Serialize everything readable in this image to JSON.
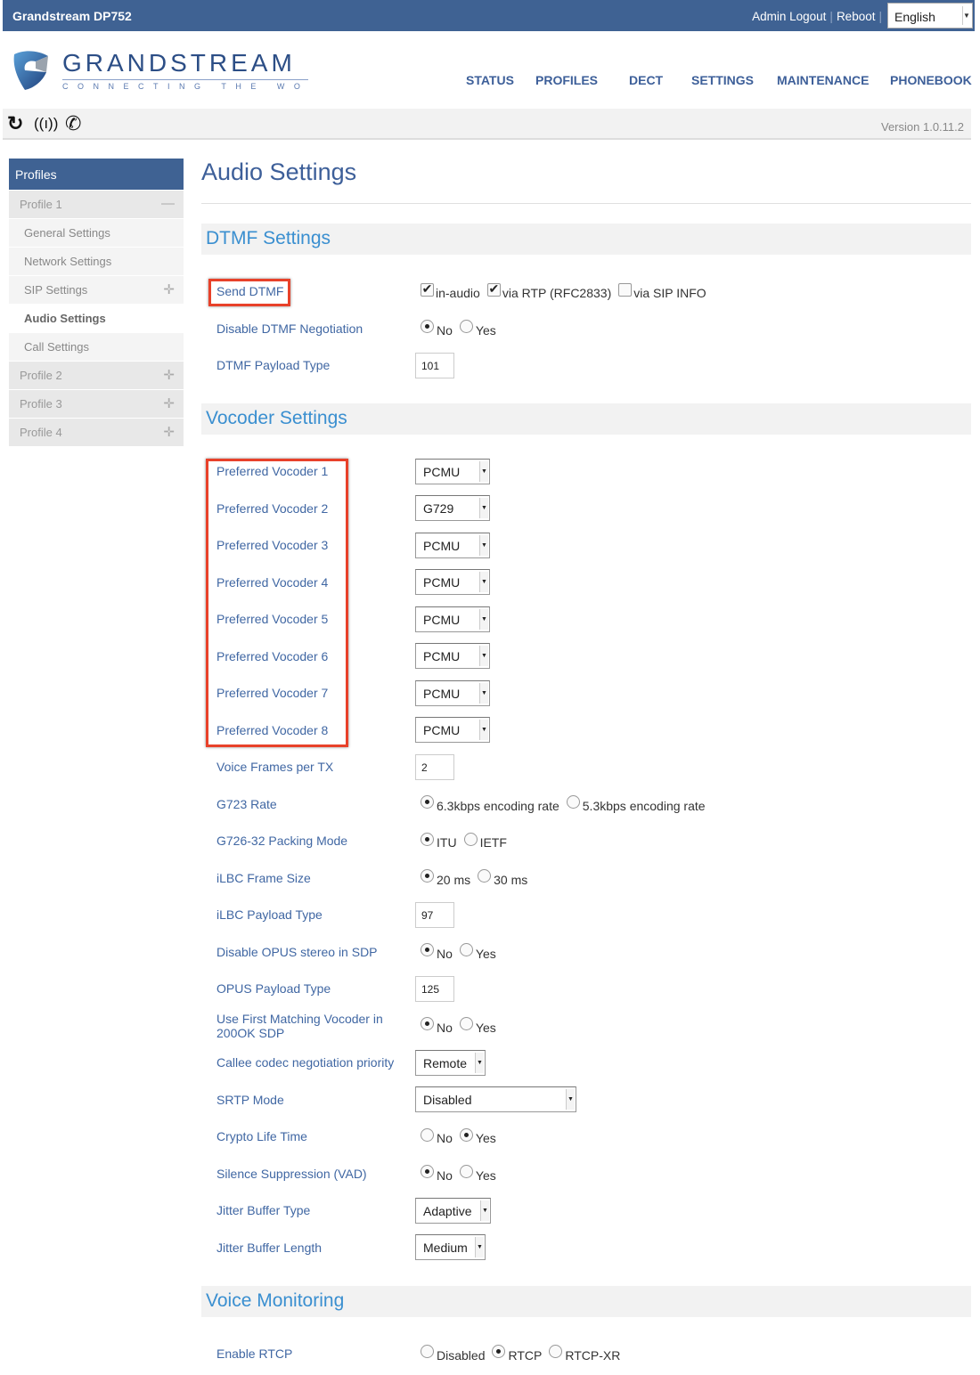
{
  "header": {
    "title": "Grandstream DP752",
    "admin_logout": "Admin Logout",
    "reboot": "Reboot",
    "language": "English"
  },
  "logo": {
    "brand": "GRANDSTREAM",
    "tagline": "CONNECTING THE WORLD"
  },
  "nav": [
    "STATUS",
    "PROFILES",
    "DECT",
    "SETTINGS",
    "MAINTENANCE",
    "PHONEBOOK"
  ],
  "toolbar": {
    "icons": [
      "refresh-icon",
      "antenna-icon",
      "phone-call-icon"
    ],
    "version": "Version 1.0.11.2"
  },
  "sidebar": {
    "title": "Profiles",
    "items": [
      {
        "label": "Profile 1",
        "type": "group",
        "expander": "minus"
      },
      {
        "label": "General Settings",
        "type": "sub"
      },
      {
        "label": "Network Settings",
        "type": "sub"
      },
      {
        "label": "SIP Settings",
        "type": "sub",
        "expander": "plus"
      },
      {
        "label": "Audio Settings",
        "type": "active"
      },
      {
        "label": "Call Settings",
        "type": "sub"
      },
      {
        "label": "Profile 2",
        "type": "group",
        "expander": "plus"
      },
      {
        "label": "Profile 3",
        "type": "group",
        "expander": "plus"
      },
      {
        "label": "Profile 4",
        "type": "group",
        "expander": "plus"
      }
    ]
  },
  "page_title": "Audio Settings",
  "sections": [
    {
      "title": "DTMF Settings",
      "rows": [
        {
          "label": "Send DTMF",
          "type": "checkbox",
          "options": [
            {
              "label": "in-audio",
              "checked": true
            },
            {
              "label": "via RTP (RFC2833)",
              "checked": true
            },
            {
              "label": "via SIP INFO",
              "checked": false
            }
          ]
        },
        {
          "label": "Disable DTMF Negotiation",
          "type": "radio",
          "options": [
            "No",
            "Yes"
          ],
          "selected": "No"
        },
        {
          "label": "DTMF Payload Type",
          "type": "text",
          "value": "101"
        }
      ]
    },
    {
      "title": "Vocoder Settings",
      "rows": [
        {
          "label": "Preferred Vocoder 1",
          "type": "select",
          "value": "PCMU"
        },
        {
          "label": "Preferred Vocoder 2",
          "type": "select",
          "value": "G729"
        },
        {
          "label": "Preferred Vocoder 3",
          "type": "select",
          "value": "PCMU"
        },
        {
          "label": "Preferred Vocoder 4",
          "type": "select",
          "value": "PCMU"
        },
        {
          "label": "Preferred Vocoder 5",
          "type": "select",
          "value": "PCMU"
        },
        {
          "label": "Preferred Vocoder 6",
          "type": "select",
          "value": "PCMU"
        },
        {
          "label": "Preferred Vocoder 7",
          "type": "select",
          "value": "PCMU"
        },
        {
          "label": "Preferred Vocoder 8",
          "type": "select",
          "value": "PCMU"
        },
        {
          "label": "Voice Frames per TX",
          "type": "text",
          "value": "2"
        },
        {
          "label": "G723 Rate",
          "type": "radio",
          "options": [
            "6.3kbps encoding rate",
            "5.3kbps encoding rate"
          ],
          "selected": "6.3kbps encoding rate"
        },
        {
          "label": "G726-32 Packing Mode",
          "type": "radio",
          "options": [
            "ITU",
            "IETF"
          ],
          "selected": "ITU"
        },
        {
          "label": "iLBC Frame Size",
          "type": "radio",
          "options": [
            "20 ms",
            "30 ms"
          ],
          "selected": "20 ms"
        },
        {
          "label": "iLBC Payload Type",
          "type": "text",
          "value": "97"
        },
        {
          "label": "Disable OPUS stereo in SDP",
          "type": "radio",
          "options": [
            "No",
            "Yes"
          ],
          "selected": "No"
        },
        {
          "label": "OPUS Payload Type",
          "type": "text",
          "value": "125"
        },
        {
          "label": "Use First Matching Vocoder in 200OK SDP",
          "type": "radio",
          "options": [
            "No",
            "Yes"
          ],
          "selected": "No"
        },
        {
          "label": "Callee codec negotiation priority",
          "type": "select",
          "value": "Remote"
        },
        {
          "label": "SRTP Mode",
          "type": "select",
          "value": "Disabled"
        },
        {
          "label": "Crypto Life Time",
          "type": "radio",
          "options": [
            "No",
            "Yes"
          ],
          "selected": "Yes"
        },
        {
          "label": "Silence Suppression (VAD)",
          "type": "radio",
          "options": [
            "No",
            "Yes"
          ],
          "selected": "No"
        },
        {
          "label": "Jitter Buffer Type",
          "type": "select",
          "value": "Adaptive"
        },
        {
          "label": "Jitter Buffer Length",
          "type": "select",
          "value": "Medium"
        }
      ]
    },
    {
      "title": "Voice Monitoring",
      "rows": [
        {
          "label": "Enable RTCP",
          "type": "radio",
          "options": [
            "Disabled",
            "RTCP",
            "RTCP-XR"
          ],
          "selected": "RTCP"
        }
      ]
    }
  ],
  "highlight_color": "#e8412a",
  "brand_color": "#3f6293"
}
